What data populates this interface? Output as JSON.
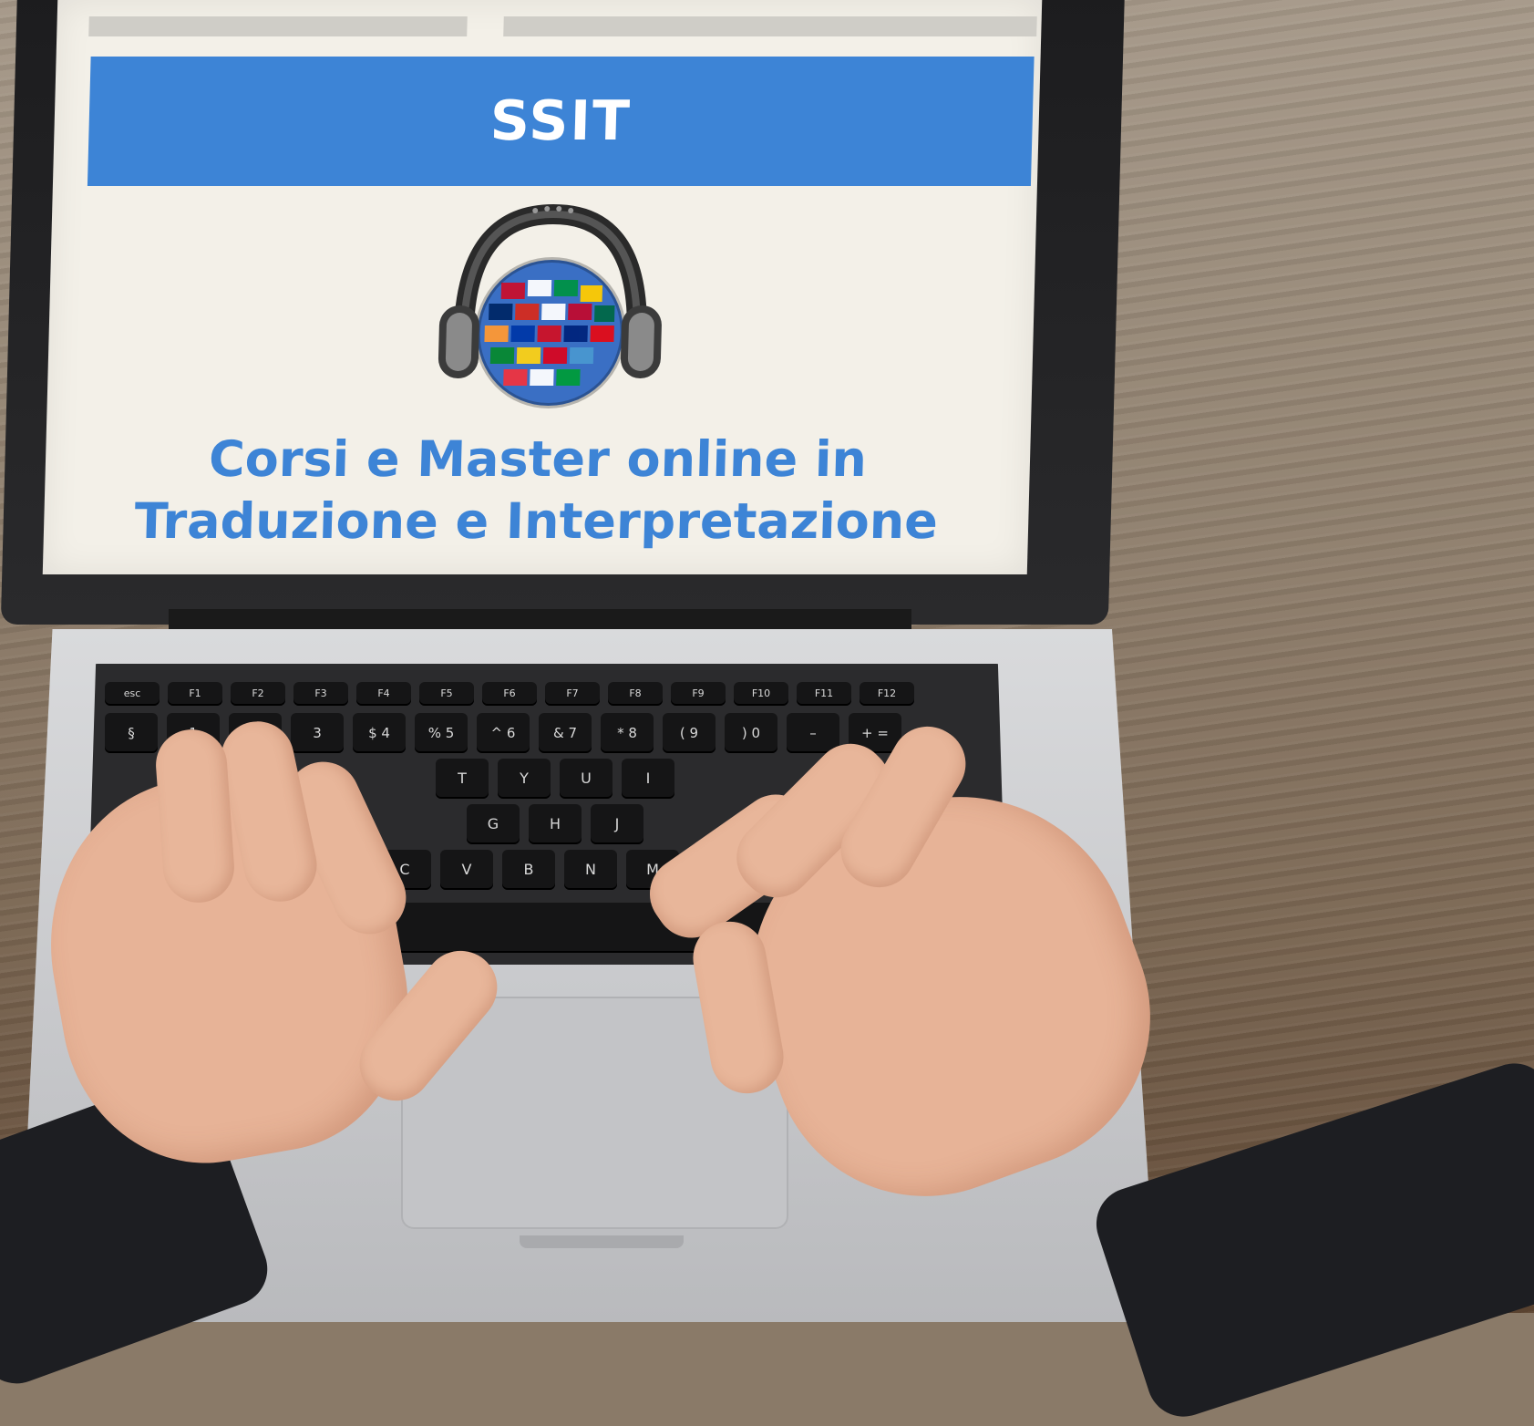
{
  "screen": {
    "banner_title": "SSIT",
    "tagline_line1": "Corsi e Master online in",
    "tagline_line2": "Traduzione e Interpretazione",
    "logo_icon": "headphones-globe-icon",
    "colors": {
      "banner": "#3d84d6",
      "tagline": "#3d84d6",
      "screen_bg": "#f3f0e8"
    }
  },
  "keyboard": {
    "row1": [
      "esc",
      "F1",
      "F2",
      "F3",
      "F4",
      "F5",
      "F6",
      "F7",
      "F8",
      "F9",
      "F10",
      "F11",
      "F12"
    ],
    "row2": [
      "§",
      "1",
      "2",
      "3",
      "$ 4",
      "% 5",
      "^ 6",
      "& 7",
      "* 8",
      "( 9",
      ") 0",
      "–",
      "+ ="
    ],
    "row3": [
      "T",
      "Y",
      "U",
      "I"
    ],
    "row4": [
      "G",
      "H",
      "J"
    ],
    "row5": [
      "C",
      "V",
      "B",
      "N",
      "M",
      "<"
    ]
  }
}
